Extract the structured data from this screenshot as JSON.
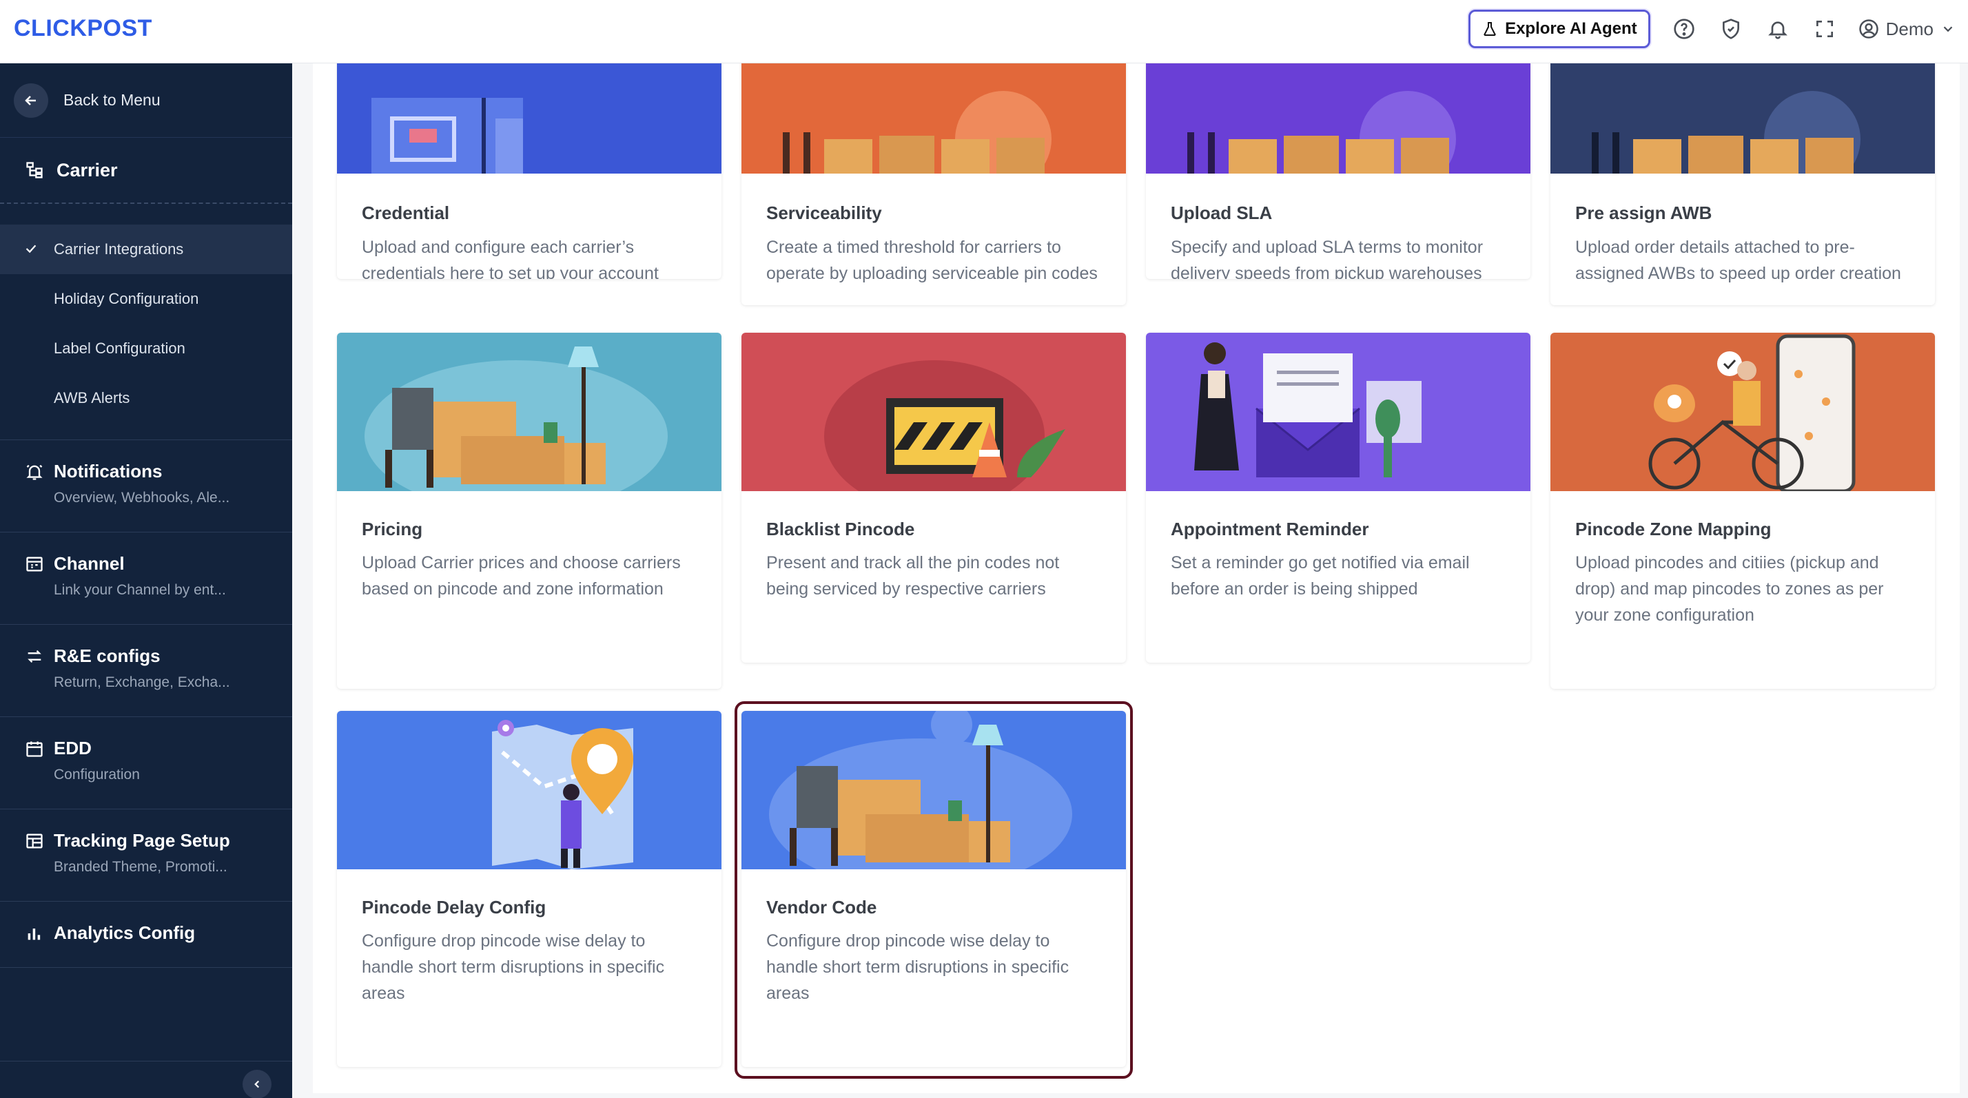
{
  "header": {
    "logo": "CLICKPOST",
    "ai_button": "Explore AI Agent",
    "user": "Demo",
    "icons": [
      "flask-icon",
      "help-icon",
      "shield-icon",
      "bell-icon",
      "fullscreen-icon",
      "user-icon",
      "chevron-down-icon"
    ]
  },
  "sidebar": {
    "back_label": "Back to Menu",
    "section_title": "Carrier",
    "sub_items": [
      {
        "label": "Carrier Integrations",
        "active": true
      },
      {
        "label": "Holiday Configuration"
      },
      {
        "label": "Label Configuration"
      },
      {
        "label": "AWB Alerts"
      }
    ],
    "sections": [
      {
        "title": "Notifications",
        "subtitle": "Overview, Webhooks, Ale..."
      },
      {
        "title": "Channel",
        "subtitle": "Link your Channel by ent..."
      },
      {
        "title": "R&E configs",
        "subtitle": "Return, Exchange, Excha..."
      },
      {
        "title": "EDD",
        "subtitle": "Configuration"
      },
      {
        "title": "Tracking Page Setup",
        "subtitle": "Branded Theme, Promoti..."
      },
      {
        "title": "Analytics Config",
        "subtitle": ""
      }
    ]
  },
  "cards": [
    {
      "title": "Credential",
      "description": "Upload and configure each carrier’s credentials here to set up your account"
    },
    {
      "title": "Serviceability",
      "description": "Create a timed threshold for carriers to operate by uploading serviceable pin codes"
    },
    {
      "title": "Upload SLA",
      "description": "Specify and upload SLA terms to monitor delivery speeds from pickup warehouses"
    },
    {
      "title": "Pre assign AWB",
      "description": "Upload order details attached to pre-assigned AWBs to speed up order creation"
    },
    {
      "title": "Pricing",
      "description": "Upload Carrier prices and choose carriers based on pincode and zone information"
    },
    {
      "title": "Blacklist Pincode",
      "description": "Present and track all the pin codes not being serviced by respective carriers"
    },
    {
      "title": "Appointment Reminder",
      "description": "Set a reminder go get notified via email before an order is being shipped"
    },
    {
      "title": "Pincode Zone Mapping",
      "description": "Upload pincodes and citiies (pickup and drop) and map pincodes to zones as per your zone configuration"
    },
    {
      "title": "Pincode Delay Config",
      "description": "Configure drop pincode wise delay to handle short term disruptions in specific areas"
    },
    {
      "title": "Vendor Code",
      "description": "Configure drop pincode wise delay to handle short term disruptions in specific areas",
      "selected": true
    }
  ],
  "colors": {
    "brand": "#2e5ce6",
    "sidebar_bg": "#13233c",
    "selected_border": "#5c1020",
    "ai_border": "#5b5bd6"
  }
}
